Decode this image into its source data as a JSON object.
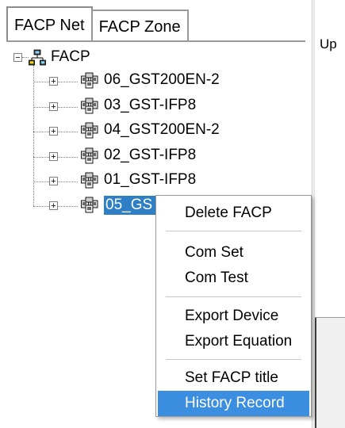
{
  "tabs": [
    {
      "label": "FACP Net",
      "active": true
    },
    {
      "label": "FACP Zone",
      "active": false
    }
  ],
  "tree": {
    "root_label": "FACP",
    "root_expander": "−",
    "child_expander": "+",
    "children": [
      {
        "label": "06_GST200EN-2"
      },
      {
        "label": "03_GST-IFP8"
      },
      {
        "label": "04_GST200EN-2"
      },
      {
        "label": "02_GST-IFP8"
      },
      {
        "label": "01_GST-IFP8"
      },
      {
        "label": "05_GS"
      }
    ],
    "selected_index": 5
  },
  "right_panel": {
    "header_fragment": "Up"
  },
  "context_menu": {
    "items": [
      {
        "label": "Delete FACP"
      },
      {
        "label": "Com Set"
      },
      {
        "label": "Com Test"
      },
      {
        "label": "Export Device"
      },
      {
        "label": "Export Equation"
      },
      {
        "label": "Set FACP title"
      },
      {
        "label": "History Record"
      }
    ],
    "highlighted_index": 6
  },
  "colors": {
    "selection": "#2e7fc4",
    "menu_highlight": "#3b8ee0"
  }
}
